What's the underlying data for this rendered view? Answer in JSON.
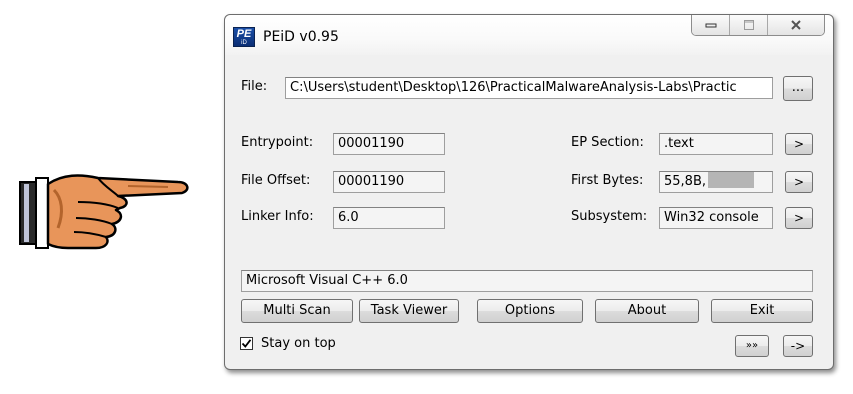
{
  "window": {
    "title": "PEiD v0.95",
    "app_icon_text": "PE",
    "app_icon_subtext": "iD"
  },
  "file": {
    "label": "File:",
    "path": "C:\\Users\\student\\Desktop\\126\\PracticalMalwareAnalysis-Labs\\Practic",
    "browse_label": "..."
  },
  "left_fields": [
    {
      "label": "Entrypoint:",
      "value": "00001190"
    },
    {
      "label": "File Offset:",
      "value": "00001190"
    },
    {
      "label": "Linker Info:",
      "value": "6.0"
    }
  ],
  "right_fields": [
    {
      "label": "EP Section:",
      "value": ".text",
      "button": ">"
    },
    {
      "label": "First Bytes:",
      "value": "55,8B,",
      "button": ">"
    },
    {
      "label": "Subsystem:",
      "value": "Win32 console",
      "button": ">"
    }
  ],
  "detection": "Microsoft Visual C++ 6.0",
  "buttons": {
    "multi_scan": "Multi Scan",
    "task_viewer": "Task Viewer",
    "options": "Options",
    "about": "About",
    "exit": "Exit"
  },
  "stay_on_top": {
    "label": "Stay on top",
    "checked": true
  },
  "bottom_buttons": {
    "expand": "»»",
    "arrow": "->"
  },
  "pointer_icon": "pointing-hand-icon"
}
